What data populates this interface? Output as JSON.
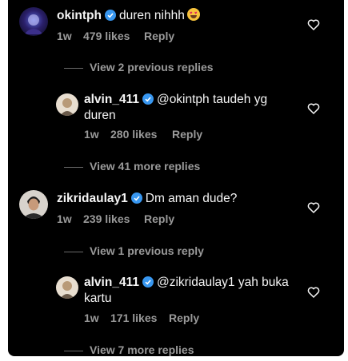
{
  "colors": {
    "background": "#000000",
    "text": "#f5f5f5",
    "muted": "#9a9a9a",
    "verified": "#3897f0"
  },
  "comments": [
    {
      "username": "okintph",
      "text": "duren nihhh",
      "emoji": "heart-eyes-emoji",
      "age": "1w",
      "likes": "479 likes",
      "reply": "Reply"
    },
    {
      "username": "alvin_411",
      "text_line1": "@okintph taudeh yg",
      "text_line2": "duren",
      "age": "1w",
      "likes": "280 likes",
      "reply": "Reply"
    },
    {
      "username": "zikridaulay1",
      "text": "Dm aman dude?",
      "age": "1w",
      "likes": "239 likes",
      "reply": "Reply"
    },
    {
      "username": "alvin_411",
      "text_line1": "@zikridaulay1 yah buka",
      "text_line2": "kartu",
      "age": "1w",
      "likes": "171 likes",
      "reply": "Reply"
    }
  ],
  "links": {
    "view_prev_1": "View 2 previous replies",
    "view_more_1": "View 41 more replies",
    "view_prev_2": "View 1 previous reply",
    "view_more_2": "View 7 more replies"
  }
}
